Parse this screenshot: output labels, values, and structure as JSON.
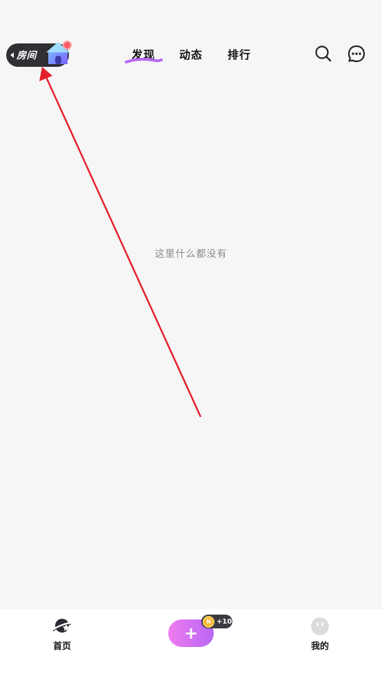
{
  "header": {
    "room_label": "房间",
    "tabs": [
      {
        "label": "发现",
        "active": true
      },
      {
        "label": "动态",
        "active": false
      },
      {
        "label": "排行",
        "active": false
      }
    ],
    "accent_color": "#b866f5"
  },
  "main": {
    "empty_message": "这里什么都没有"
  },
  "bottom_nav": {
    "home_label": "首页",
    "me_label": "我的",
    "coin_badge": "+10",
    "coin_glyph": "N",
    "plus_glyph": "+"
  },
  "annotation": {
    "color": "#e3202a"
  }
}
